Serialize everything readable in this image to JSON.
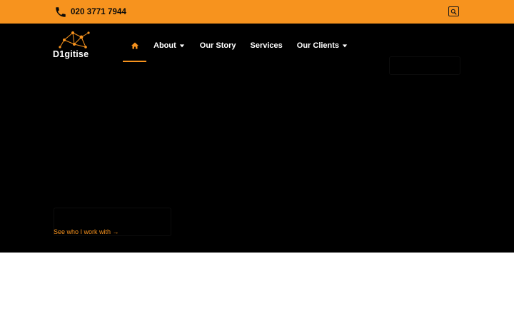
{
  "topbar": {
    "phone_icon": "phone-icon",
    "phone": "020 3771 7944",
    "search_icon": "search-icon"
  },
  "brand": {
    "logo_text": "D1gitise",
    "colors": {
      "accent": "#f7931e",
      "hero_bg": "#000000",
      "text": "#ffffff"
    }
  },
  "nav": {
    "home_icon": "home-icon",
    "items": [
      {
        "label": "About",
        "has_dropdown": true
      },
      {
        "label": "Our Story",
        "has_dropdown": false
      },
      {
        "label": "Services",
        "has_dropdown": false
      },
      {
        "label": "Our Clients",
        "has_dropdown": true
      }
    ]
  },
  "hero": {
    "cta_link": "See who I work with →"
  }
}
